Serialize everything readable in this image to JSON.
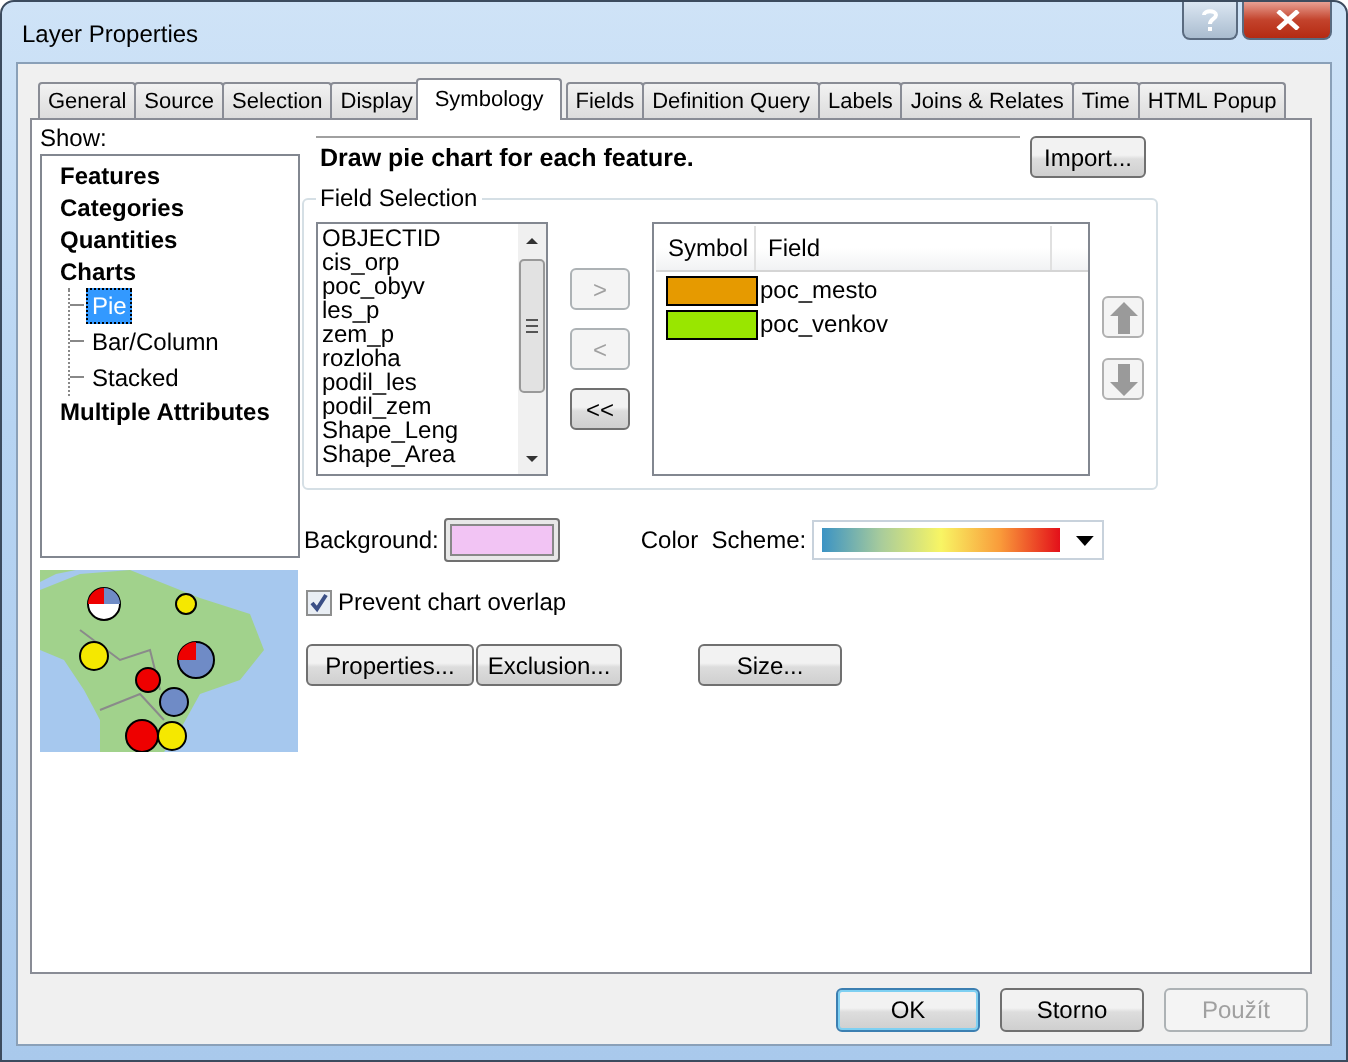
{
  "window": {
    "title": "Layer Properties"
  },
  "tabs": [
    {
      "label": "General",
      "selected": false
    },
    {
      "label": "Source",
      "selected": false
    },
    {
      "label": "Selection",
      "selected": false
    },
    {
      "label": "Display",
      "selected": false
    },
    {
      "label": "Symbology",
      "selected": true
    },
    {
      "label": "Fields",
      "selected": false
    },
    {
      "label": "Definition Query",
      "selected": false
    },
    {
      "label": "Labels",
      "selected": false
    },
    {
      "label": "Joins & Relates",
      "selected": false
    },
    {
      "label": "Time",
      "selected": false
    },
    {
      "label": "HTML Popup",
      "selected": false
    }
  ],
  "show_label": "Show:",
  "tree": [
    {
      "label": "Features",
      "selected": false
    },
    {
      "label": "Categories",
      "selected": false
    },
    {
      "label": "Quantities",
      "selected": false
    },
    {
      "label": "Charts",
      "selected": false,
      "children": [
        {
          "label": "Pie",
          "selected": true
        },
        {
          "label": "Bar/Column",
          "selected": false
        },
        {
          "label": "Stacked",
          "selected": false
        }
      ]
    },
    {
      "label": "Multiple Attributes",
      "selected": false
    }
  ],
  "description": "Draw pie chart for each feature.",
  "import_button": "Import...",
  "field_selection": {
    "title": "Field Selection",
    "available_fields": [
      "OBJECTID",
      "cis_orp",
      "poc_obyv",
      "les_p",
      "zem_p",
      "rozloha",
      "podil_les",
      "podil_zem",
      "Shape_Leng",
      "Shape_Area"
    ],
    "move_buttons": [
      {
        "label": ">",
        "disabled": true
      },
      {
        "label": "<",
        "disabled": true
      },
      {
        "label": "<<",
        "disabled": false
      }
    ],
    "columns": [
      "Symbol",
      "Field"
    ],
    "selected_fields": [
      {
        "field": "poc_mesto",
        "color": "#e69a00"
      },
      {
        "field": "poc_venkov",
        "color": "#99e600"
      }
    ]
  },
  "background": {
    "label": "Background:",
    "color": "#f2c4f4"
  },
  "color_scheme": {
    "label": "Color  Scheme:"
  },
  "prevent_overlap": {
    "label": "Prevent chart overlap",
    "checked": true
  },
  "buttons": [
    "Properties...",
    "Exclusion...",
    "Size..."
  ],
  "dialog_buttons": [
    {
      "label": "OK",
      "default": true,
      "disabled": false
    },
    {
      "label": "Storno",
      "default": false,
      "disabled": false
    },
    {
      "label": "Použít",
      "default": false,
      "disabled": true
    }
  ]
}
